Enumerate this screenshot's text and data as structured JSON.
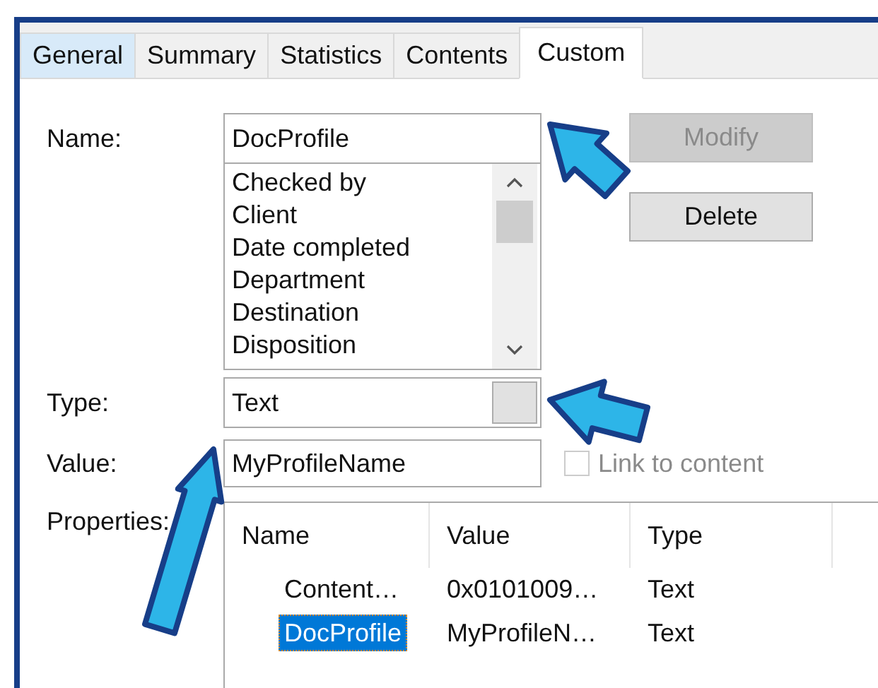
{
  "tabs": [
    {
      "label": "General",
      "selected": false,
      "hovered": true
    },
    {
      "label": "Summary",
      "selected": false,
      "hovered": false
    },
    {
      "label": "Statistics",
      "selected": false,
      "hovered": false
    },
    {
      "label": "Contents",
      "selected": false,
      "hovered": false
    },
    {
      "label": "Custom",
      "selected": true,
      "hovered": false
    }
  ],
  "name": {
    "label": "Name:",
    "value": "DocProfile",
    "options": [
      "Checked by",
      "Client",
      "Date completed",
      "Department",
      "Destination",
      "Disposition"
    ]
  },
  "buttons": [
    {
      "label": "Modify",
      "disabled": true
    },
    {
      "label": "Delete",
      "disabled": false
    }
  ],
  "type": {
    "label": "Type:",
    "value": "Text"
  },
  "value": {
    "label": "Value:",
    "value": "MyProfileName"
  },
  "link_to_content": {
    "label": "Link to content",
    "checked": false,
    "disabled": true
  },
  "properties": {
    "label": "Properties:",
    "columns": [
      "Name",
      "Value",
      "Type"
    ],
    "rows": [
      {
        "name": "Content…",
        "value": "0x0101009…",
        "type": "Text",
        "selected": false
      },
      {
        "name": "DocProfile",
        "value": "MyProfileN…",
        "type": "Text",
        "selected": true
      }
    ]
  },
  "callout_arrows": [
    {
      "kind": "arrow"
    },
    {
      "kind": "arrow"
    },
    {
      "kind": "arrow"
    }
  ]
}
